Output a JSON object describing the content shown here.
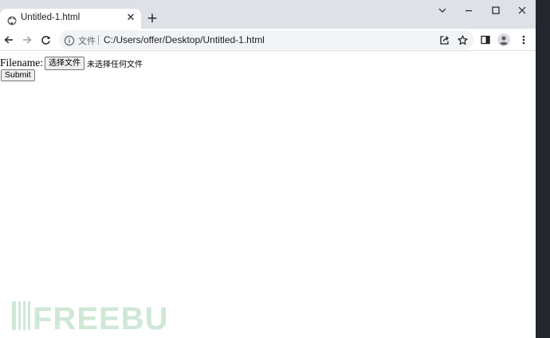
{
  "browser": {
    "tab": {
      "title": "Untitled-1.html",
      "favicon": "globe-icon",
      "close_icon": "close-icon"
    },
    "new_tab_icon": "plus-icon",
    "window_controls": [
      "chevron-down-icon",
      "minimize-icon",
      "maximize-icon",
      "close-icon"
    ],
    "nav": [
      "back-arrow-icon",
      "forward-arrow-icon",
      "reload-icon"
    ],
    "omnibox": {
      "info_icon": "info-icon",
      "scheme_label": "文件",
      "url": "C:/Users/offer/Desktop/Untitled-1.html"
    },
    "toolbar_icons": [
      "share-icon",
      "star-icon",
      "side-panel-icon",
      "profile-icon",
      "kebab-menu-icon"
    ],
    "colors": {
      "tabstrip": "#dee1e6",
      "omnibox": "#f1f3f4",
      "page": "#ffffff"
    }
  },
  "page": {
    "filename_label": "Filename:",
    "choose_file_button": "选择文件",
    "no_file_text": "未选择任何文件",
    "submit_button": "Submit"
  },
  "watermark": {
    "text": "FREEBUF",
    "color": "#cfe8d6"
  }
}
